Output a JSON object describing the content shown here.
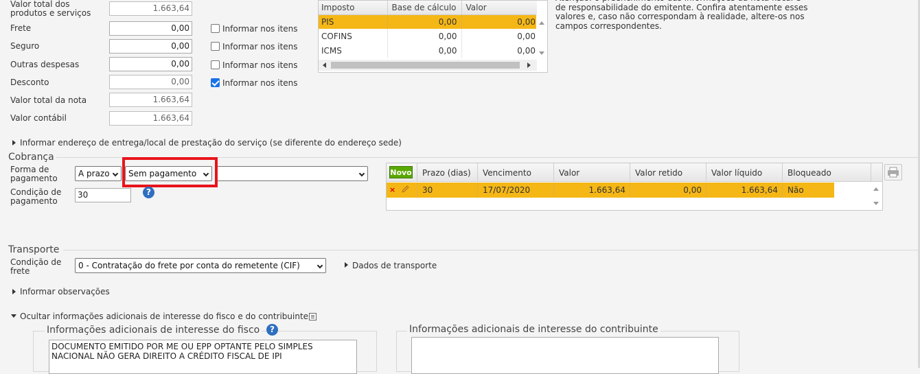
{
  "totals": {
    "rows": [
      {
        "label": "Valor total dos produtos e serviços",
        "value": "1.663,64",
        "readonly": true,
        "check": null
      },
      {
        "label": "Frete",
        "value": "0,00",
        "readonly": false,
        "check": {
          "label": "Informar nos itens",
          "checked": false
        }
      },
      {
        "label": "Seguro",
        "value": "0,00",
        "readonly": false,
        "check": {
          "label": "Informar nos itens",
          "checked": false
        }
      },
      {
        "label": "Outras despesas",
        "value": "0,00",
        "readonly": false,
        "check": {
          "label": "Informar nos itens",
          "checked": false
        }
      },
      {
        "label": "Desconto",
        "value": "0,00",
        "readonly": true,
        "check": {
          "label": "Informar nos itens",
          "checked": true
        }
      },
      {
        "label": "Valor total da nota",
        "value": "1.663,64",
        "readonly": true,
        "check": null
      },
      {
        "label": "Valor contábil",
        "value": "1.663,64",
        "readonly": true,
        "check": null
      }
    ]
  },
  "taxes": {
    "headers": [
      "Imposto",
      "Base de cálculo",
      "Valor"
    ],
    "rows": [
      [
        "PIS",
        "0,00",
        "0,00"
      ],
      [
        "COFINS",
        "0,00",
        "0,00"
      ],
      [
        "ICMS",
        "0,00",
        "0,00"
      ]
    ]
  },
  "notice": "Atenção: o preenchimento das informações da nota fiscal é de responsabilidade do emitente. Confira atentamente esses valores e, caso não correspondam à realidade, altere-os nos campos correspondentes.",
  "delivery_toggle": "Informar endereço de entrega/local de prestação do serviço (se diferente do endereço sede)",
  "cobranca": {
    "title": "Cobrança",
    "forma_label": "Forma de pagamento",
    "forma_value": "A prazo",
    "meio_value": "Sem pagamento",
    "extra_value": "",
    "condicao_label": "Condição de pagamento",
    "condicao_value": "30",
    "help_icon": "question-circle-icon",
    "novo_label": "Novo",
    "grid_headers": [
      "Prazo (dias)",
      "Vencimento",
      "Valor",
      "Valor retido",
      "Valor líquido",
      "Bloqueado"
    ],
    "grid_rows": [
      [
        "30",
        "17/07/2020",
        "1.663,64",
        "0,00",
        "1.663,64",
        "Não"
      ]
    ]
  },
  "transporte": {
    "title": "Transporte",
    "condicao_label": "Condição de frete",
    "condicao_value": "0 - Contratação do frete por conta do remetente (CIF)",
    "dados_label": "Dados de transporte"
  },
  "observacoes_toggle": "Informar observações",
  "fisco_toggle": "Ocultar informações adicionais de interesse do fisco e do contribuinte",
  "fisco": {
    "title": "Informações adicionais de interesse do fisco",
    "text": "DOCUMENTO EMITIDO POR ME OU EPP OPTANTE PELO SIMPLES NACIONAL NÃO GERA DIREITO A CRÉDITO FISCAL DE IPI"
  },
  "contribuinte": {
    "title": "Informações adicionais de interesse do contribuinte",
    "text": ""
  },
  "colors": {
    "highlight": "#f5b716",
    "novo": "#5aa800",
    "check": "#1a73e8",
    "annotation": "#e8141b"
  }
}
